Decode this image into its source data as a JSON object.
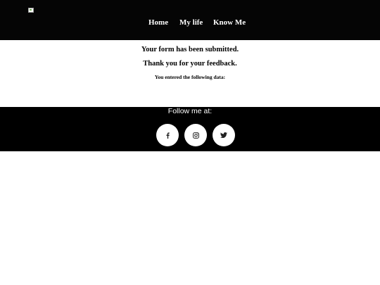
{
  "nav": {
    "items": [
      {
        "label": "Home"
      },
      {
        "label": "My life"
      },
      {
        "label": "Know Me"
      }
    ]
  },
  "content": {
    "submitted": "Your form has been submitted.",
    "thanks": "Thank you for your feedback.",
    "entered": "You entered the following data:"
  },
  "footer": {
    "follow_label": "Follow me at:",
    "social": [
      {
        "icon": "facebook-icon"
      },
      {
        "icon": "instagram-icon"
      },
      {
        "icon": "twitter-icon"
      }
    ]
  }
}
